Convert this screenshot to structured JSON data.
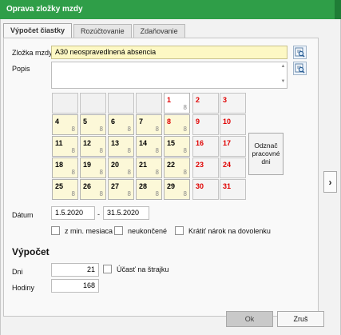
{
  "window": {
    "title": "Oprava zložky mzdy"
  },
  "tabs": [
    {
      "label": "Výpočet čiastky"
    },
    {
      "label": "Rozúčtovanie"
    },
    {
      "label": "Zdaňovanie"
    }
  ],
  "form": {
    "zlozka_label": "Zložka mzdy",
    "zlozka_value": "A30  neospravedlnená absencia",
    "popis_label": "Popis",
    "popis_value": ""
  },
  "calendar": {
    "days": [
      {
        "day": "1",
        "hours": "8"
      },
      {
        "day": "2",
        "hours": ""
      },
      {
        "day": "3",
        "hours": ""
      },
      {
        "day": "4",
        "hours": "8"
      },
      {
        "day": "5",
        "hours": "8"
      },
      {
        "day": "6",
        "hours": "8"
      },
      {
        "day": "7",
        "hours": "8"
      },
      {
        "day": "8",
        "hours": "8"
      },
      {
        "day": "9",
        "hours": ""
      },
      {
        "day": "10",
        "hours": ""
      },
      {
        "day": "11",
        "hours": "8"
      },
      {
        "day": "12",
        "hours": "8"
      },
      {
        "day": "13",
        "hours": "8"
      },
      {
        "day": "14",
        "hours": "8"
      },
      {
        "day": "15",
        "hours": "8"
      },
      {
        "day": "16",
        "hours": ""
      },
      {
        "day": "17",
        "hours": ""
      },
      {
        "day": "18",
        "hours": "8"
      },
      {
        "day": "19",
        "hours": "8"
      },
      {
        "day": "20",
        "hours": "8"
      },
      {
        "day": "21",
        "hours": "8"
      },
      {
        "day": "22",
        "hours": "8"
      },
      {
        "day": "23",
        "hours": ""
      },
      {
        "day": "24",
        "hours": ""
      },
      {
        "day": "25",
        "hours": "8"
      },
      {
        "day": "26",
        "hours": "8"
      },
      {
        "day": "27",
        "hours": "8"
      },
      {
        "day": "28",
        "hours": "8"
      },
      {
        "day": "29",
        "hours": "8"
      },
      {
        "day": "30",
        "hours": ""
      },
      {
        "day": "31",
        "hours": ""
      }
    ],
    "mark_button_label": "Odznač pracovné dni"
  },
  "date": {
    "label": "Dátum",
    "from": "1.5.2020",
    "separator": "-",
    "to": "31.5.2020"
  },
  "options": {
    "z_min_mesiaca": "z min. mesiaca",
    "neukoncene": "neukončené",
    "kratit_narok": "Krátiť nárok na dovolenku"
  },
  "vypocet": {
    "heading": "Výpočet",
    "dni_label": "Dni",
    "dni_value": "21",
    "ucast_label": "Účasť na štrajku",
    "hodiny_label": "Hodiny",
    "hodiny_value": "168"
  },
  "buttons": {
    "ok": "Ok",
    "cancel": "Zruš"
  },
  "icons": {
    "lookup": "search-list-icon",
    "side": "chevron-right-icon"
  },
  "colors": {
    "titlebar": "#2f9e48",
    "workday": "#fcf8d8",
    "holiday_text": "#e00000"
  }
}
